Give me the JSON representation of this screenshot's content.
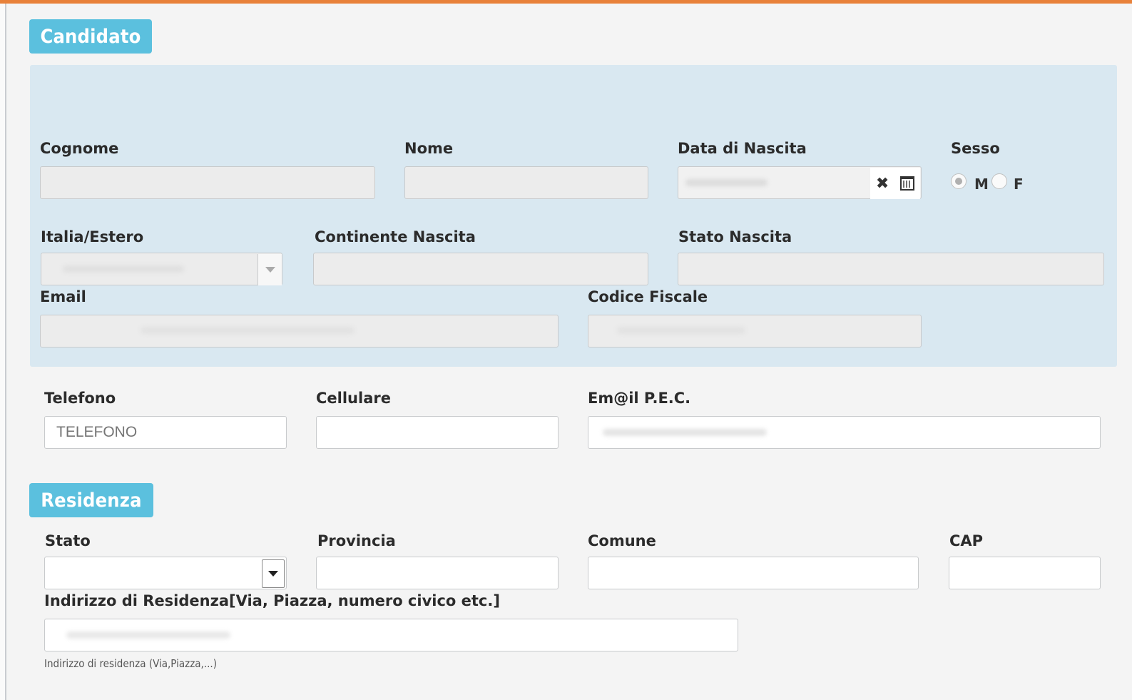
{
  "candidato": {
    "title": "Candidato",
    "labels": {
      "cognome": "Cognome",
      "nome": "Nome",
      "data_nascita": "Data di Nascita",
      "sesso": "Sesso",
      "italia_estero": "Italia/Estero",
      "continente_nascita": "Continente Nascita",
      "stato_nascita": "Stato Nascita",
      "email": "Email",
      "codice_fiscale": "Codice Fiscale"
    },
    "sesso_options": [
      "M",
      "F"
    ],
    "sesso_selected": "M",
    "date_clear_icon": "✖"
  },
  "contatti": {
    "labels": {
      "telefono": "Telefono",
      "cellulare": "Cellulare",
      "pec": "Em@il P.E.C."
    },
    "telefono_placeholder": "TELEFONO"
  },
  "residenza": {
    "title": "Residenza",
    "labels": {
      "stato": "Stato",
      "provincia": "Provincia",
      "comune": "Comune",
      "cap": "CAP",
      "indirizzo": "Indirizzo di Residenza[Via, Piazza, numero civico etc.]"
    },
    "indirizzo_help": "Indirizzo di residenza (Via,Piazza,...)"
  },
  "colors": {
    "accent_bar": "#e8813a",
    "section_tab": "#5bc0de",
    "panel_bg": "#d9e8f1"
  }
}
